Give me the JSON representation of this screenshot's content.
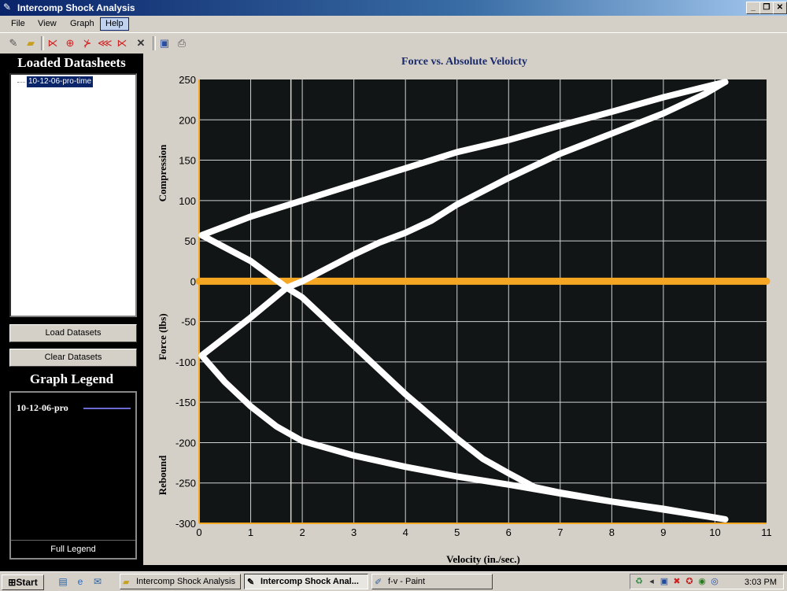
{
  "window": {
    "title": "Intercomp Shock Analysis",
    "icon": "wrench-icon",
    "controls": [
      "_",
      "□",
      "✕"
    ]
  },
  "menu": [
    "File",
    "View",
    "Graph",
    "Help"
  ],
  "menu_active": "Help",
  "toolbar": {
    "icons": [
      "wrench-icon",
      "open-folder-icon",
      "graph-tool-1-icon",
      "graph-tool-2-icon",
      "graph-tool-3-icon",
      "graph-tool-4-icon",
      "graph-tool-5-icon",
      "delete-icon",
      "save-icon",
      "print-icon"
    ]
  },
  "left_panel": {
    "datasheets_title": "Loaded Datasheets",
    "datasheets": [
      "10-12-06-pro-time"
    ],
    "load_button": "Load Datasets",
    "clear_button": "Clear Datasets",
    "legend_title": "Graph Legend",
    "legend_items": [
      {
        "name": "10-12-06-pro",
        "color": "#6a6ad0"
      }
    ],
    "full_legend_button": "Full Legend"
  },
  "chart_data": {
    "type": "line",
    "title": "Force vs. Absolute Veloicty",
    "xlabel": "Velocity (in./sec.)",
    "ylabel": "Force (lbs)",
    "ylabel_top": "Compression",
    "ylabel_bottom": "Rebound",
    "xlim": [
      0,
      11
    ],
    "ylim": [
      -300,
      250
    ],
    "x_ticks": [
      0,
      1,
      2,
      3,
      4,
      5,
      6,
      7,
      8,
      9,
      10,
      11
    ],
    "y_ticks": [
      250,
      200,
      150,
      100,
      50,
      0,
      -50,
      -100,
      -150,
      -200,
      -250,
      -300
    ],
    "grid": true,
    "background": "#121516",
    "zero_line_color": "#f5a623",
    "cursor_x": 1.78,
    "series": [
      {
        "color": "#ffffff",
        "x": [
          0.05,
          1,
          2,
          3,
          4,
          5,
          6,
          7,
          8,
          9,
          10.2,
          9.8,
          9,
          8,
          7,
          6,
          5,
          4.5,
          4,
          3.5,
          3,
          2,
          1.7,
          1,
          0.05,
          0.5,
          1,
          1.5,
          2,
          3,
          4,
          5,
          6,
          7,
          8,
          9,
          10.2,
          9,
          8,
          7,
          6.5,
          6,
          5.5,
          5,
          4,
          3,
          2,
          1.7,
          1,
          0.05
        ],
        "y": [
          57,
          80,
          100,
          120,
          140,
          160,
          175,
          193,
          210,
          228,
          247,
          232,
          208,
          183,
          158,
          128,
          95,
          75,
          60,
          48,
          33,
          0,
          -8,
          -45,
          -92,
          -125,
          -155,
          -180,
          -198,
          -216,
          -230,
          -242,
          -252,
          -263,
          -273,
          -283,
          -295,
          -282,
          -273,
          -262,
          -255,
          -238,
          -220,
          -195,
          -140,
          -80,
          -20,
          -8,
          25,
          57
        ]
      }
    ],
    "zero_line": {
      "x": [
        0,
        11
      ],
      "y": [
        0,
        0
      ]
    }
  },
  "taskbar": {
    "start": "Start",
    "quick_launch": [
      "desktop-icon",
      "ie-icon",
      "outlook-icon"
    ],
    "tasks": [
      {
        "label": "Intercomp Shock Analysis",
        "icon": "folder-icon",
        "pressed": false
      },
      {
        "label": "Intercomp Shock Anal...",
        "icon": "wrench-icon",
        "pressed": true
      },
      {
        "label": "f-v - Paint",
        "icon": "paint-icon",
        "pressed": false
      }
    ],
    "tray_icons": [
      "tray-icon-1",
      "volume-icon",
      "network-icon",
      "tray-icon-4",
      "tray-icon-5",
      "antivirus-icon",
      "tray-icon-7"
    ],
    "clock": "3:03 PM"
  }
}
